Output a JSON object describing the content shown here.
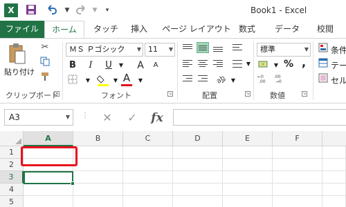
{
  "window": {
    "title": "Book1 - Excel",
    "app_icon_text": "X"
  },
  "tabs": [
    {
      "label": "ファイル"
    },
    {
      "label": "ホーム"
    },
    {
      "label": "タッチ"
    },
    {
      "label": "挿入"
    },
    {
      "label": "ページ レイアウト"
    },
    {
      "label": "数式"
    },
    {
      "label": "データ"
    },
    {
      "label": "校閲"
    }
  ],
  "ribbon": {
    "clipboard": {
      "paste_label": "貼り付け",
      "group_label": "クリップボード"
    },
    "font": {
      "font_name": "ＭＳ Ｐゴシック",
      "font_size": "11",
      "bold": "B",
      "italic": "I",
      "underline": "U",
      "font_color_glyph": "A",
      "size_up": "A",
      "size_down": "A",
      "group_label": "フォント"
    },
    "alignment": {
      "group_label": "配置"
    },
    "number": {
      "format": "標準",
      "percent": "%",
      "comma": ",",
      "group_label": "数値"
    },
    "styles": {
      "conditional": "条件",
      "table": "テー",
      "cell": "セル"
    }
  },
  "formula_bar": {
    "name_box": "A3",
    "fx_label": "fx",
    "content": ""
  },
  "grid": {
    "columns": [
      "A",
      "B",
      "C",
      "D",
      "E",
      "F"
    ],
    "rows": [
      "1",
      "2",
      "3",
      "4",
      "5"
    ],
    "selected_cell": "A3"
  },
  "colors": {
    "accent": "#217346",
    "highlight": "#e8101d",
    "font_color_bar": "#e8101d",
    "fill_color_bar": "#ffff00"
  }
}
